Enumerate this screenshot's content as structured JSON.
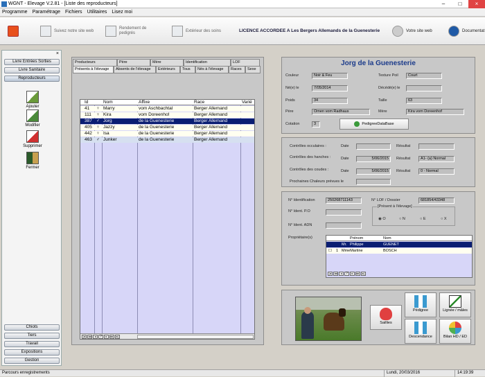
{
  "window": {
    "title": "WGNT - Elevage V.2.81 - [Liste des reproducteurs]"
  },
  "menu": [
    "Programme",
    "Paramétrage",
    "Fichiers",
    "Utilitaires",
    "Lisez moi"
  ],
  "toolbar": {
    "website_label": "Suivez notre site web",
    "pedigree_label": "Rendement de pedigrés",
    "kennel_label": "Extérieur des soins",
    "licence": "LICENCE ACCORDEE A   Les Bergers Allemands de la Guenesterie",
    "yoursite_label": "Votre site web",
    "doc_label": "Documentat"
  },
  "leftnav": {
    "top_buttons": [
      "Livre Entrées Sorties",
      "Livre Sanitaire",
      "Reproducteurs"
    ],
    "actions": [
      "Ajouter",
      "Modifier",
      "Supprimer",
      "Fermer"
    ],
    "bottom_buttons": [
      "Chiots",
      "Tiers",
      "Travail",
      "Expositions",
      "Gestion"
    ]
  },
  "tabs_row1": [
    "Producteurs",
    "Père",
    "Mère",
    "Identification",
    "LOF"
  ],
  "tabs_row2": [
    "Présents à l'élevage",
    "Absents de l'élevage",
    "Extérieurs",
    "Tous",
    "Nés à l'élevage",
    "Races",
    "Sexe"
  ],
  "grid": {
    "headers": [
      "Id",
      "",
      "Nom",
      "Affixe",
      "Race",
      "Varié"
    ],
    "rows": [
      {
        "id": "41",
        "sex": "♀",
        "nom": "Marry",
        "affixe": "vom Aschbachtal",
        "race": "Berger Allemand"
      },
      {
        "id": "111",
        "sex": "♀",
        "nom": "Kira",
        "affixe": "vom Doreenhof",
        "race": "Berger Allemand"
      },
      {
        "id": "387",
        "sex": "♂",
        "nom": "Jorg",
        "affixe": "de la Guenesterie",
        "race": "Berger Allemand"
      },
      {
        "id": "405",
        "sex": "♀",
        "nom": "Jazzy",
        "affixe": "de la Guenesterie",
        "race": "Berger Allemand"
      },
      {
        "id": "442",
        "sex": "♀",
        "nom": "Isa",
        "affixe": "de la Guenesterie",
        "race": "Berger Allemand"
      },
      {
        "id": "463",
        "sex": "♂",
        "nom": "Junker",
        "affixe": "de la Guenesterie",
        "race": "Berger Allemand"
      }
    ],
    "pager": "?"
  },
  "detail": {
    "name": "Jorg de la Guenesterie",
    "couleur_label": "Couleur",
    "couleur": "Noir & Feu",
    "texture_label": "Texture Poil",
    "texture": "Court",
    "ne_label": "Né(e) le",
    "ne": "7/05/2014",
    "decede_label": "Décédé(e) le",
    "decede": "",
    "poids_label": "Poids",
    "poids": "34",
    "taille_label": "Taille",
    "taille": "63",
    "pere_label": "Père",
    "pere": "Omen vom Radhaus",
    "mere_label": "Mère",
    "mere": "Kira vom Doreenhof",
    "cotation_label": "Cotation",
    "cotation": "3",
    "pedigree_btn": "PedigreeDataBase"
  },
  "controls": {
    "occ_label": "Contrôles occulaires :",
    "date_label": "Date",
    "result_label": "Résultat",
    "hanches_label": "Contrôles des hanches :",
    "hanches_date": "5/06/2015",
    "hanches_result": "A1- (a) Normal",
    "coudes_label": "Contrôles des coudes :",
    "coudes_date": "5/06/2015",
    "coudes_result": "0 - Normal",
    "chaleurs_label": "Prochaines Chaleurs prévues le"
  },
  "ident": {
    "no_label": "N° Identification",
    "no": "250268711143",
    "lof_label": "N° LOF / Dossier",
    "lof": "681854/43348",
    "po_label": "N° Ident. P.O",
    "adn_label": "N° Ident. ADN",
    "present_label": "[Présent à l'élevage]",
    "present_opts": [
      "O",
      "N",
      "E",
      "X"
    ],
    "prop_label": "Propriétaire(s)",
    "prop_headers": [
      "",
      "Prénom",
      "Nom"
    ],
    "owners": [
      {
        "civ": "Mr.",
        "prenom": "Philippe",
        "nom": "GUENET"
      },
      {
        "civ": "MmeMartine",
        "prenom": "",
        "nom": "BOSCH"
      }
    ],
    "pager": "?"
  },
  "actions": {
    "saillies": "Saillies",
    "pedigree": "Pédigree",
    "lignee": "Lignée / mâles",
    "descendance": "Descendance",
    "bilan": "Bilan HD / ED"
  },
  "status": {
    "left": "Parcours enregistrements",
    "date": "Lundi, 20/03/2016",
    "time": "14:19:39"
  }
}
